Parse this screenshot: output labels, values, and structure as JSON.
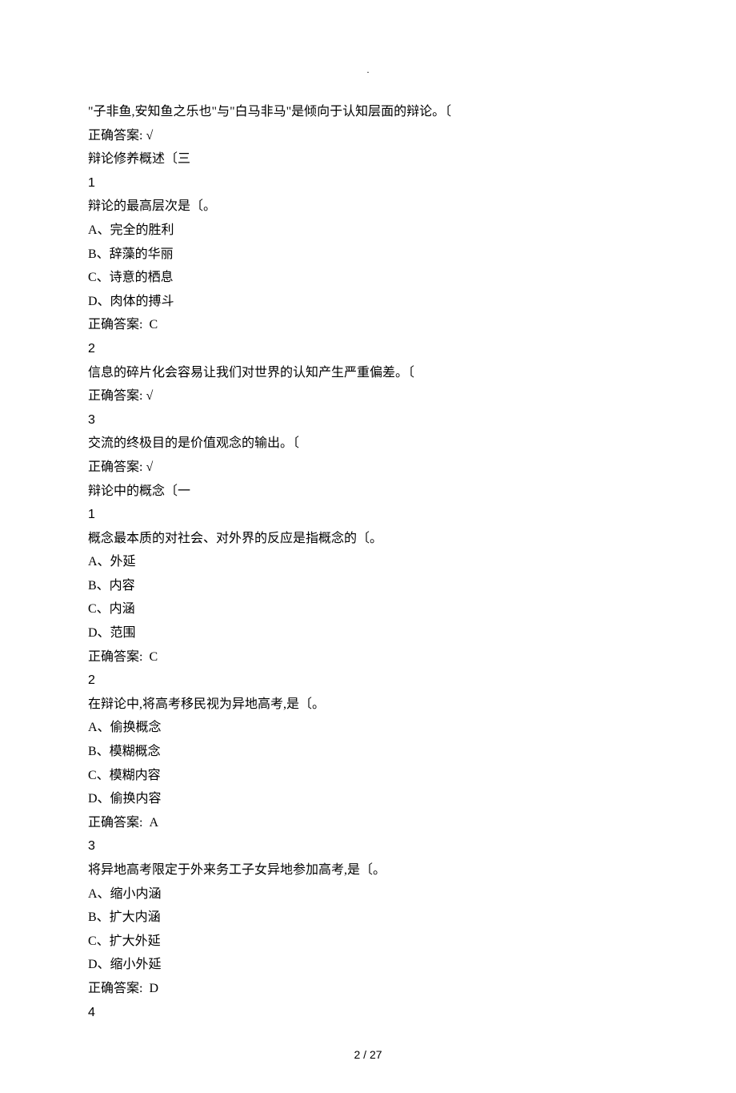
{
  "header": ".",
  "lines": [
    {
      "text": "\"子非鱼,安知鱼之乐也\"与\"白马非马\"是倾向于认知层面的辩论。〔",
      "ascii": false
    },
    {
      "text": "正确答案: √",
      "ascii": false
    },
    {
      "text": "辩论修养概述〔三",
      "ascii": false
    },
    {
      "text": "1",
      "ascii": true
    },
    {
      "text": "辩论的最高层次是〔。",
      "ascii": false
    },
    {
      "text": "A、完全的胜利",
      "ascii": false
    },
    {
      "text": "B、辞藻的华丽",
      "ascii": false
    },
    {
      "text": "C、诗意的栖息",
      "ascii": false
    },
    {
      "text": "D、肉体的搏斗",
      "ascii": false
    },
    {
      "text": "正确答案:  C",
      "ascii": false
    },
    {
      "text": "2",
      "ascii": true
    },
    {
      "text": "信息的碎片化会容易让我们对世界的认知产生严重偏差。〔",
      "ascii": false
    },
    {
      "text": "正确答案: √",
      "ascii": false
    },
    {
      "text": "3",
      "ascii": true
    },
    {
      "text": "交流的终极目的是价值观念的输出。〔",
      "ascii": false
    },
    {
      "text": "正确答案: √",
      "ascii": false
    },
    {
      "text": "辩论中的概念〔一",
      "ascii": false
    },
    {
      "text": "1",
      "ascii": true
    },
    {
      "text": "概念最本质的对社会、对外界的反应是指概念的〔。",
      "ascii": false
    },
    {
      "text": "A、外延",
      "ascii": false
    },
    {
      "text": "B、内容",
      "ascii": false
    },
    {
      "text": "C、内涵",
      "ascii": false
    },
    {
      "text": "D、范围",
      "ascii": false
    },
    {
      "text": "正确答案:  C",
      "ascii": false
    },
    {
      "text": "2",
      "ascii": true
    },
    {
      "text": "在辩论中,将高考移民视为异地高考,是〔。",
      "ascii": false
    },
    {
      "text": "A、偷换概念",
      "ascii": false
    },
    {
      "text": "B、模糊概念",
      "ascii": false
    },
    {
      "text": "C、模糊内容",
      "ascii": false
    },
    {
      "text": "D、偷换内容",
      "ascii": false
    },
    {
      "text": "正确答案:  A",
      "ascii": false
    },
    {
      "text": "3",
      "ascii": true
    },
    {
      "text": "将异地高考限定于外来务工子女异地参加高考,是〔。",
      "ascii": false
    },
    {
      "text": "A、缩小内涵",
      "ascii": false
    },
    {
      "text": "B、扩大内涵",
      "ascii": false
    },
    {
      "text": "C、扩大外延",
      "ascii": false
    },
    {
      "text": "D、缩小外延",
      "ascii": false
    },
    {
      "text": "正确答案:  D",
      "ascii": false
    },
    {
      "text": "4",
      "ascii": true
    }
  ],
  "footer": "2 / 27"
}
